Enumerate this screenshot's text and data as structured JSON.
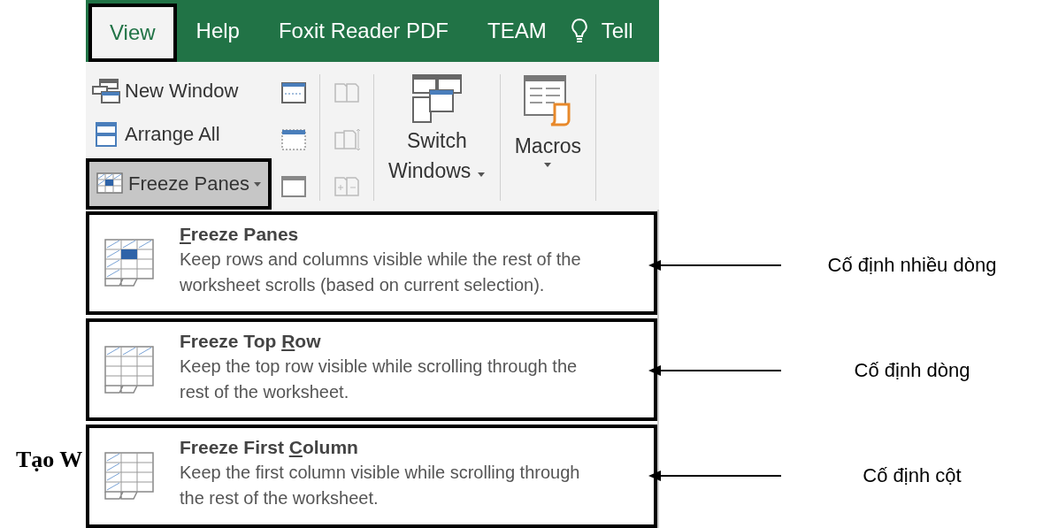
{
  "document_heading": "Tạo W",
  "tabs": [
    {
      "label": "View",
      "selected": true
    },
    {
      "label": "Help",
      "selected": false
    },
    {
      "label": "Foxit Reader PDF",
      "selected": false
    },
    {
      "label": "TEAM",
      "selected": false
    }
  ],
  "tell_me": "Tell",
  "ribbon": {
    "window_buttons": [
      {
        "label": "New Window",
        "pressed": false,
        "dropdown": false
      },
      {
        "label": "Arrange All",
        "pressed": false,
        "dropdown": false
      },
      {
        "label": "Freeze Panes",
        "pressed": true,
        "dropdown": true
      }
    ],
    "switch_windows": [
      "Switch",
      "Windows"
    ],
    "macros": "Macros"
  },
  "freeze_menu": [
    {
      "access_key": "F",
      "title_post": "reeze Panes",
      "description": "Keep rows and columns visible while the rest of the worksheet scrolls (based on current selection).",
      "kind": "panes"
    },
    {
      "title_pre": "Freeze Top ",
      "access_key": "R",
      "title_post": "ow",
      "description": "Keep the top row visible while scrolling through the rest of the worksheet.",
      "kind": "row"
    },
    {
      "title_pre": "Freeze First ",
      "access_key": "C",
      "title_post": "olumn",
      "description": "Keep the first column visible while scrolling through the rest of the worksheet.",
      "kind": "column"
    }
  ],
  "annotations": [
    "Cố định nhiều dòng",
    "Cố định dòng",
    "Cố định cột"
  ]
}
